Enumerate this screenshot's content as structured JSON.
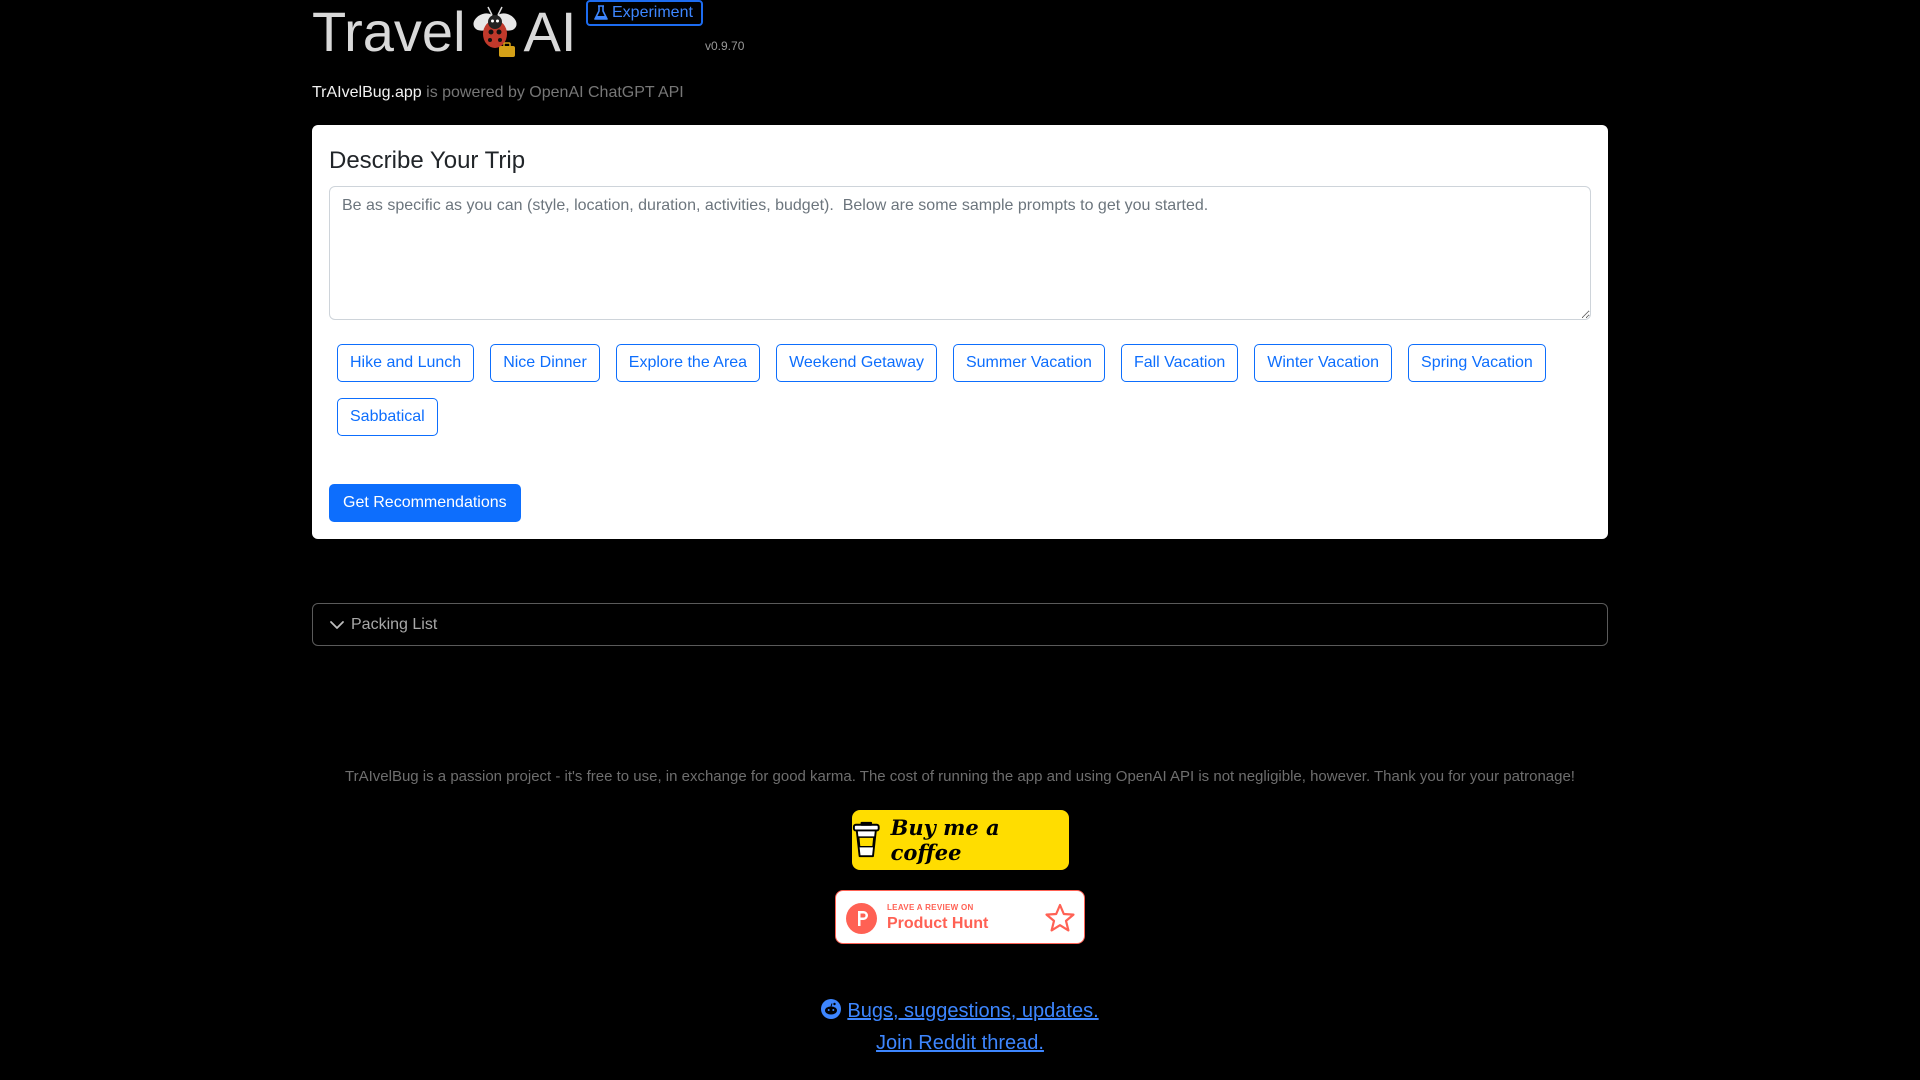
{
  "header": {
    "title_left": "Travel",
    "title_right": "AI",
    "logo_icon": "ladybug-bot-icon",
    "experiment_label": "Experiment",
    "version": "v0.9.70",
    "brand": "TrAIvelBug.app",
    "powered_by": " is powered by OpenAI ChatGPT API"
  },
  "card": {
    "title": "Describe Your Trip",
    "input_value": "",
    "input_placeholder": "Be as specific as you can (style, location, duration, activities, budget).  Below are some sample prompts to get you started.",
    "prompts": [
      "Hike and Lunch",
      "Nice Dinner",
      "Explore the Area",
      "Weekend Getaway",
      "Summer Vacation",
      "Fall Vacation",
      "Winter Vacation",
      "Spring Vacation",
      "Sabbatical"
    ],
    "submit_label": "Get Recommendations"
  },
  "accordion": {
    "label": "Packing List",
    "icon": "chevron-down-icon"
  },
  "footer": {
    "text": "TrAIvelBug is a passion project - it's free to use, in exchange for good karma. The cost of running the app and using OpenAI API is not negligible, however. Thank you for your patronage!",
    "coffee_label": "Buy me a coffee",
    "ph_small": "LEAVE A REVIEW ON",
    "ph_big": "Product Hunt",
    "link1": "Bugs, suggestions, updates.",
    "link2": "Join Reddit thread."
  },
  "colors": {
    "background": "#000000",
    "primary": "#0d6efd",
    "coffee_yellow": "#ffdd00",
    "product_hunt": "#ff6154"
  }
}
